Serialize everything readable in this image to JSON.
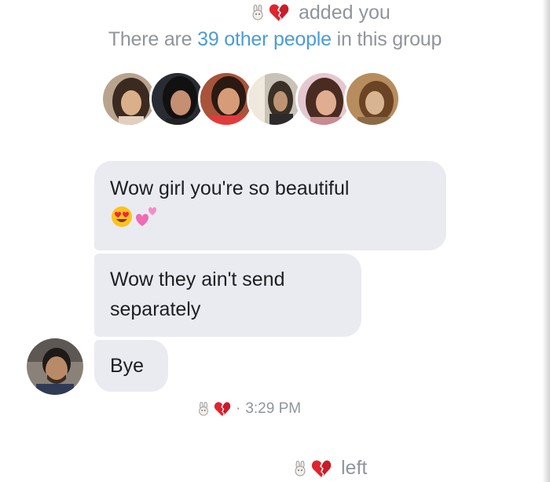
{
  "system": {
    "added_text": "added you",
    "group_prefix": "There are ",
    "group_link": "39 other people",
    "group_suffix": " in this group"
  },
  "avatars": [
    "member-1",
    "member-2",
    "member-3",
    "member-4",
    "member-5",
    "member-6"
  ],
  "messages": [
    {
      "text": "Wow girl you're so beautiful",
      "emojis": [
        "heart-eyes-emoji",
        "two-hearts-emoji"
      ]
    },
    {
      "text_line1": "Wow they ain't send",
      "text_line2": "separately"
    },
    {
      "text": "Bye"
    }
  ],
  "receipt": {
    "separator": "·",
    "time": "3:29 PM"
  },
  "footer": {
    "left_text": "left"
  },
  "colors": {
    "bubble": "#e9ebf0",
    "meta_text": "#90949c",
    "link": "#4b9bd6",
    "broken_heart": "#e0242f"
  }
}
